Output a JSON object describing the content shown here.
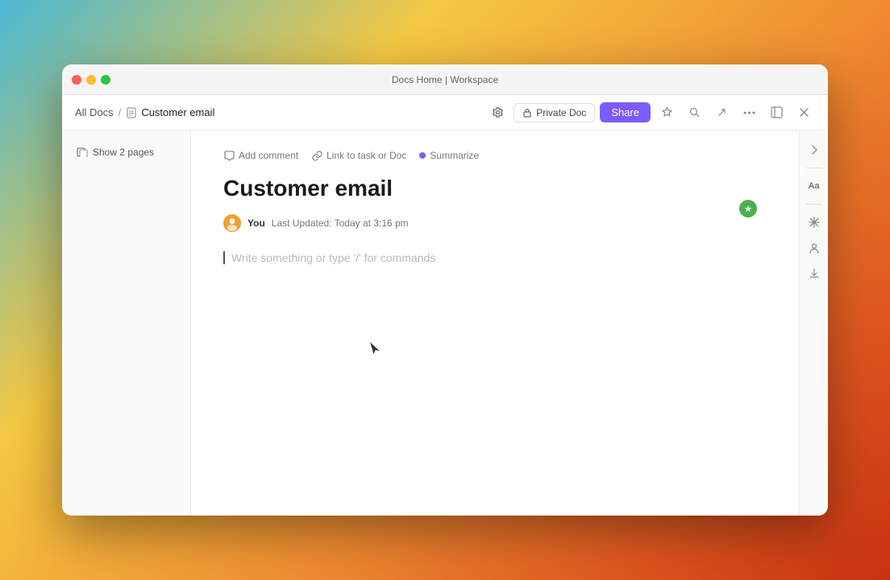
{
  "window": {
    "title": "Docs Home | Workspace"
  },
  "titlebar": {
    "title": "Docs Home | Workspace",
    "trafficLights": [
      "close",
      "minimize",
      "maximize"
    ]
  },
  "breadcrumb": {
    "all_docs": "All Docs",
    "separator": "/",
    "current": "Customer email"
  },
  "toolbar": {
    "private_doc_label": "Private Doc",
    "share_label": "Share"
  },
  "sidebar": {
    "show_pages_label": "Show 2 pages"
  },
  "actions": {
    "add_comment": "Add comment",
    "link_to_task": "Link to task or Doc",
    "summarize": "Summarize"
  },
  "doc": {
    "title": "Customer email",
    "author": "You",
    "last_updated": "Last Updated: Today at 3:16 pm",
    "placeholder": "Write something or type '/' for commands"
  },
  "icons": {
    "comment": "💬",
    "link": "🔗",
    "star": "⭐",
    "search": "🔍",
    "export": "↗",
    "more": "•••",
    "collapse": "←",
    "close": "✕",
    "font": "Aa",
    "snowflake": "❄",
    "person": "👤",
    "download": "⬇"
  }
}
